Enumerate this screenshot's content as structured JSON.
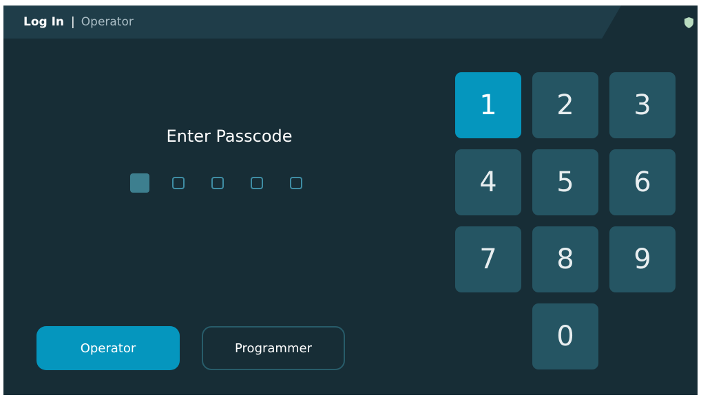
{
  "header": {
    "title": "Log In",
    "separator": "|",
    "subtitle": "Operator",
    "status_icon": "shield-icon"
  },
  "passcode": {
    "title": "Enter Passcode",
    "length": 5,
    "entered": 1
  },
  "keypad": {
    "keys": [
      "1",
      "2",
      "3",
      "4",
      "5",
      "6",
      "7",
      "8",
      "9",
      "0"
    ],
    "active_key": "1"
  },
  "modes": {
    "operator_label": "Operator",
    "programmer_label": "Programmer",
    "selected": "Operator"
  },
  "colors": {
    "background": "#172d36",
    "header": "#1f3d49",
    "accent": "#0596be",
    "key": "#255563",
    "dot_border": "#3f8da4",
    "dot_filled": "#3d7f8f"
  }
}
